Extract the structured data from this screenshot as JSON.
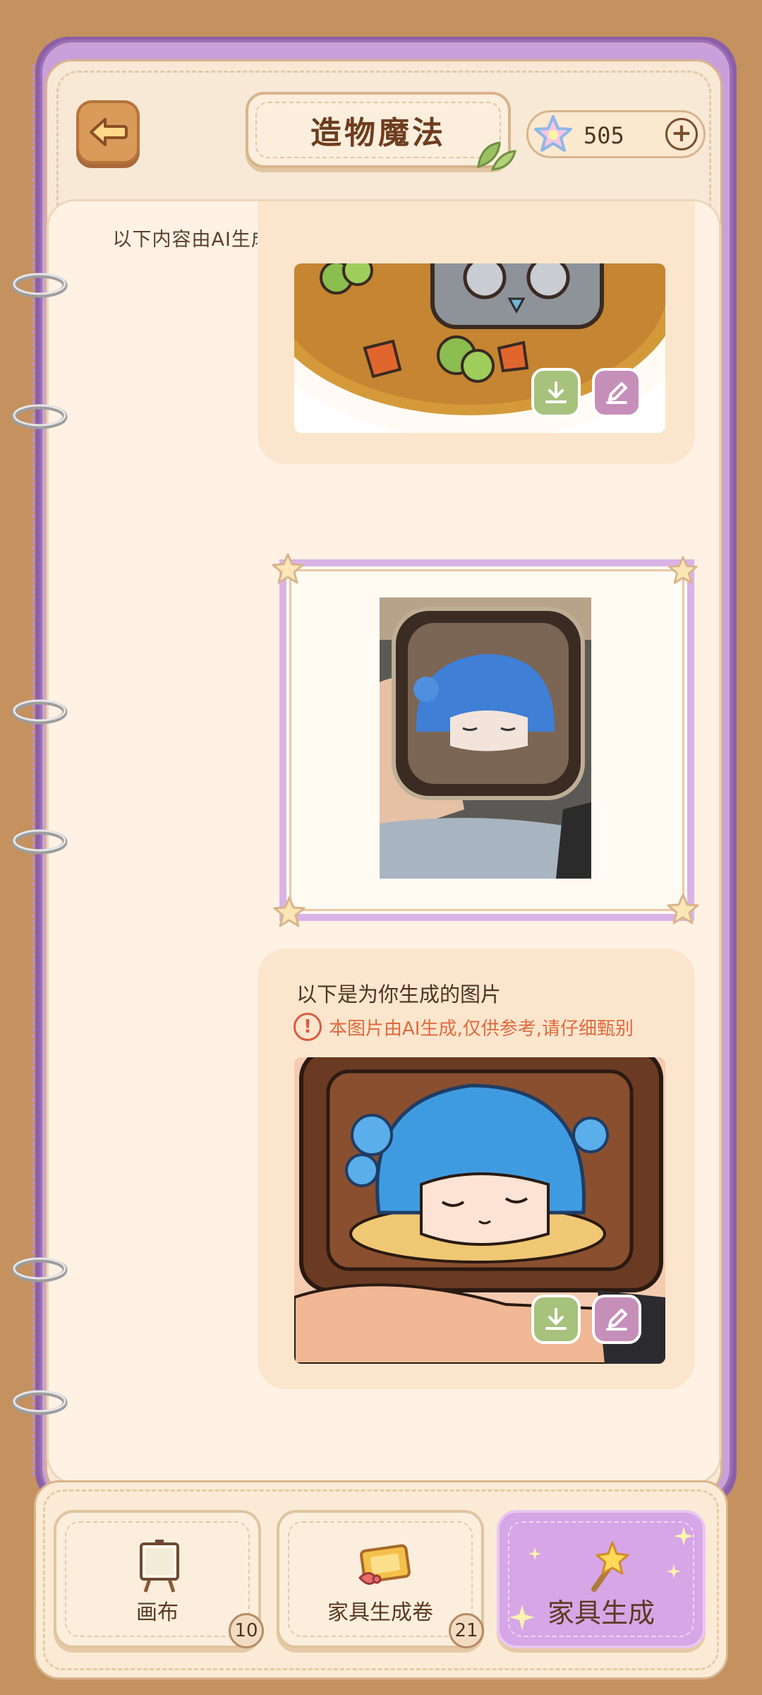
{
  "header": {
    "title": "造物魔法",
    "coins": "505",
    "add_label": "+"
  },
  "notice": "以下内容由AI生成,请选择背景干净,主体居中的图片,效果更佳!",
  "result": {
    "title": "以下是为你生成的图片",
    "warning": "本图片由AI生成,仅供参考,请仔细甄别",
    "warning_icon": "!"
  },
  "tabs": [
    {
      "label": "画布",
      "badge": "10",
      "icon": "easel-icon"
    },
    {
      "label": "家具生成卷",
      "badge": "21",
      "icon": "ticket-icon"
    },
    {
      "label": "家具生成",
      "badge": "",
      "icon": "magic-wand-icon",
      "active": true
    }
  ],
  "colors": {
    "background": "#c4915f",
    "book_cover": "#c9a0d9",
    "page": "#f7e9d6",
    "active_tab": "#d6a6e6",
    "download_button": "#a7c27c",
    "edit_button": "#c58fba",
    "warning": "#e06a3e"
  }
}
